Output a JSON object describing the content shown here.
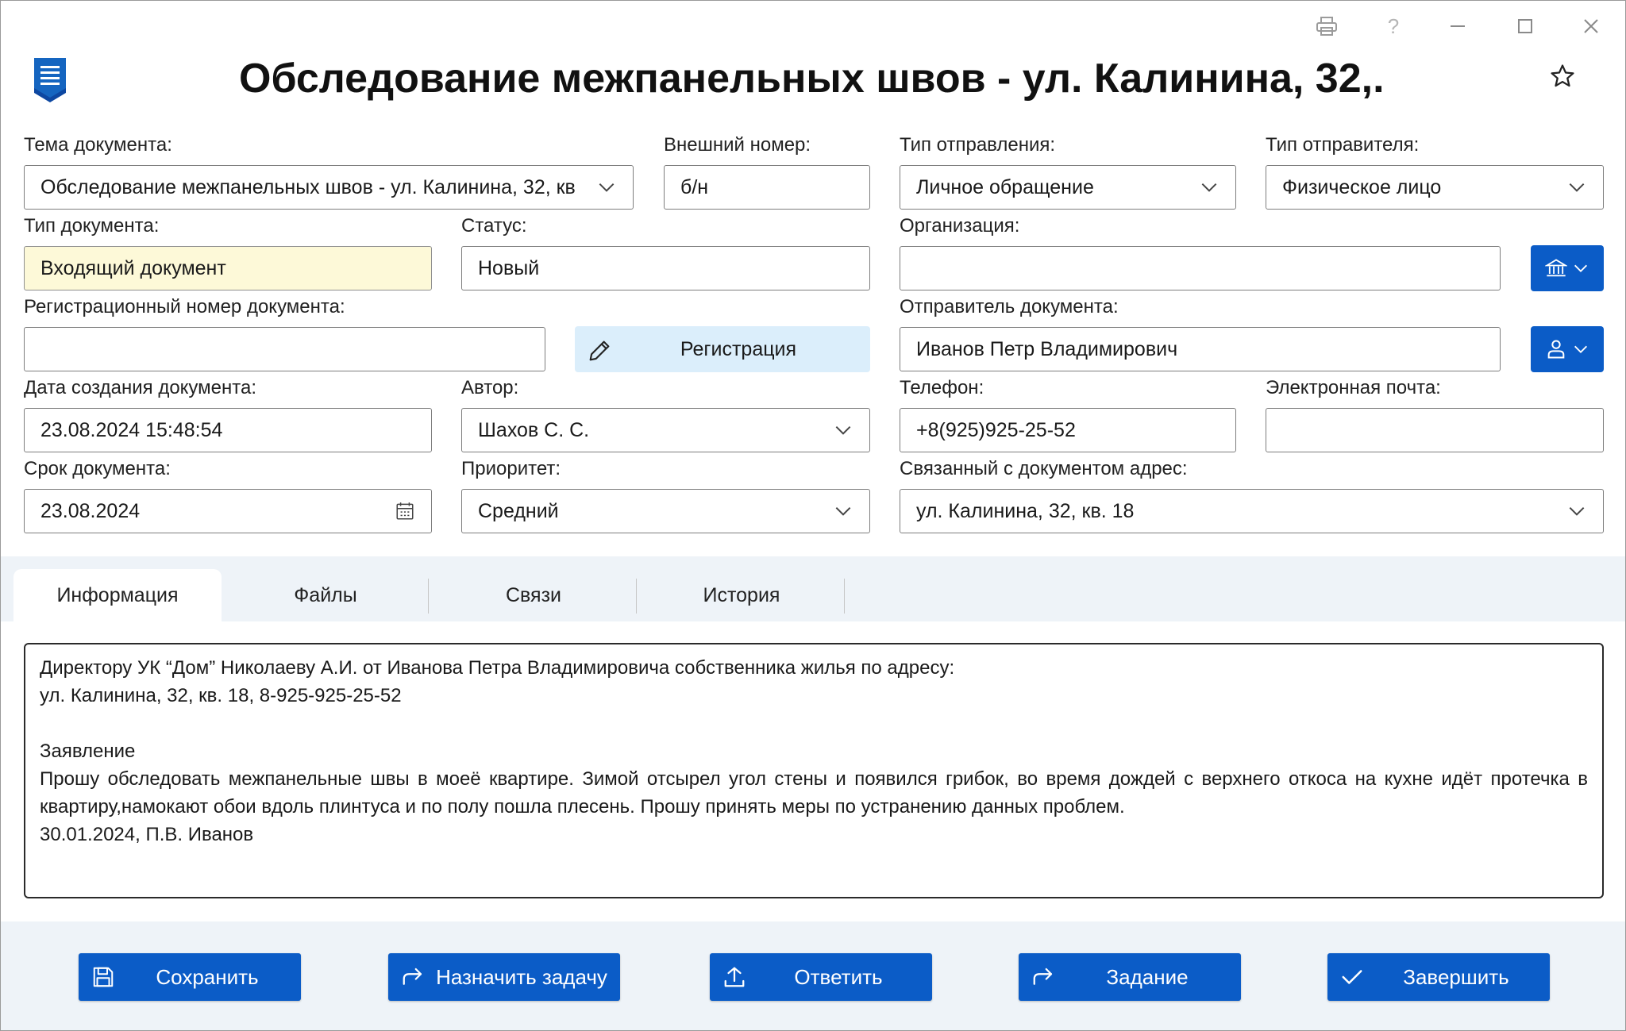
{
  "window": {
    "title": "Обследование межпанельных швов - ул. Калинина, 32,...",
    "controls": [
      "printer-icon",
      "help-icon",
      "minimize-icon",
      "maximize-icon",
      "close-icon"
    ],
    "help_glyph": "?"
  },
  "form": {
    "subject": {
      "label": "Тема документа:",
      "value": "Обследование межпанельных швов - ул. Калинина, 32, кв"
    },
    "external_number": {
      "label": "Внешний номер:",
      "value": "б/н"
    },
    "send_type": {
      "label": "Тип отправления:",
      "value": "Личное обращение"
    },
    "sender_type": {
      "label": "Тип отправителя:",
      "value": "Физическое лицо"
    },
    "doc_type": {
      "label": "Тип документа:",
      "value": "Входящий документ"
    },
    "status": {
      "label": "Статус:",
      "value": "Новый"
    },
    "organization": {
      "label": "Организация:",
      "value": ""
    },
    "reg_number": {
      "label": "Регистрационный номер документа:",
      "value": ""
    },
    "register_button": "Регистрация",
    "sender": {
      "label": "Отправитель документа:",
      "value": "Иванов Петр Владимирович"
    },
    "created": {
      "label": "Дата создания документа:",
      "value": "23.08.2024 15:48:54"
    },
    "author": {
      "label": "Автор:",
      "value": "Шахов С. С."
    },
    "phone": {
      "label": "Телефон:",
      "value": "+8(925)925-25-52"
    },
    "email": {
      "label": "Электронная почта:",
      "value": ""
    },
    "deadline": {
      "label": "Срок документа:",
      "value": "23.08.2024"
    },
    "priority": {
      "label": "Приоритет:",
      "value": "Средний"
    },
    "address": {
      "label": "Связанный с документом адрес:",
      "value": "ул. Калинина, 32, кв. 18"
    }
  },
  "tabs": [
    {
      "label": "Информация",
      "active": true
    },
    {
      "label": "Файлы",
      "active": false
    },
    {
      "label": "Связи",
      "active": false
    },
    {
      "label": "История",
      "active": false
    }
  ],
  "content": {
    "line1": "Директору УК “Дом” Николаеву А.И. от Иванова Петра Владимировича собственника жилья по адресу:",
    "line2": "ул. Калинина, 32, кв. 18, 8-925-925-25-52",
    "line3": "Заявление",
    "line4": "Прошу обследовать межпанельные швы в моеё квартире. Зимой отсырел угол стены и появился грибок, во время дождей с верхнего откоса на кухне идёт протечка в квартиру,намокают обои вдоль плинтуса и по полу пошла плесень. Прошу принять меры по устранению данных проблем.",
    "line5": "30.01.2024, П.В. Иванов"
  },
  "actions": {
    "save": "Сохранить",
    "assign": "Назначить задачу",
    "reply": "Ответить",
    "task": "Задание",
    "finish": "Завершить"
  },
  "colors": {
    "accent": "#0b5cc7",
    "register_bg": "#dbeefb",
    "doc_type_bg": "#fdf9d8",
    "bar_bg": "#eef3f8"
  }
}
